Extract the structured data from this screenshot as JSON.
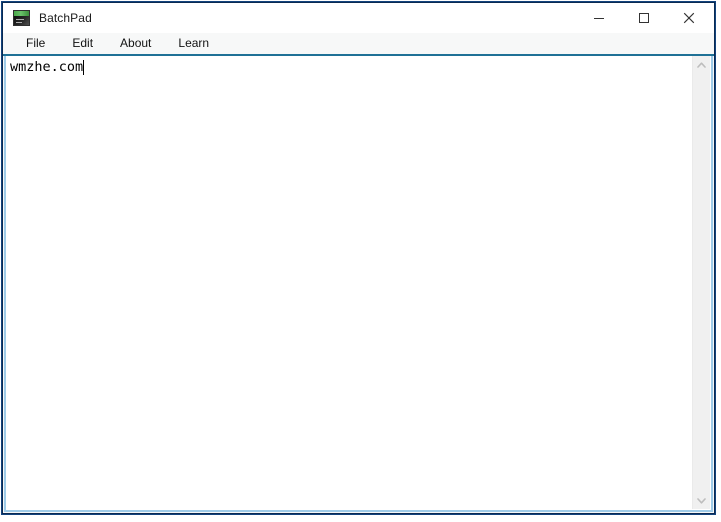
{
  "window": {
    "title": "BatchPad",
    "icon": "batchpad-app-icon",
    "controls": {
      "minimize_label": "Minimize",
      "maximize_label": "Maximize",
      "close_label": "Close"
    }
  },
  "menubar": {
    "items": [
      {
        "label": "File",
        "name": "menu-file"
      },
      {
        "label": "Edit",
        "name": "menu-edit"
      },
      {
        "label": "About",
        "name": "menu-about"
      },
      {
        "label": "Learn",
        "name": "menu-learn"
      }
    ]
  },
  "editor": {
    "text": "wmzhe.com",
    "placeholder": "",
    "caret_after_text": true
  },
  "scrollbar": {
    "up_arrow": "chevron-up-icon",
    "down_arrow": "chevron-down-icon"
  },
  "colors": {
    "window_border_outer": "#0a2a52",
    "window_border_inner": "#9ecbe8",
    "menu_underline": "#1f7196",
    "titlebar_bg": "#ffffff",
    "menubar_bg": "#f7f8f8",
    "editor_bg": "#ffffff",
    "text": "#000000",
    "scrollbar_bg": "#f0f0f0"
  }
}
